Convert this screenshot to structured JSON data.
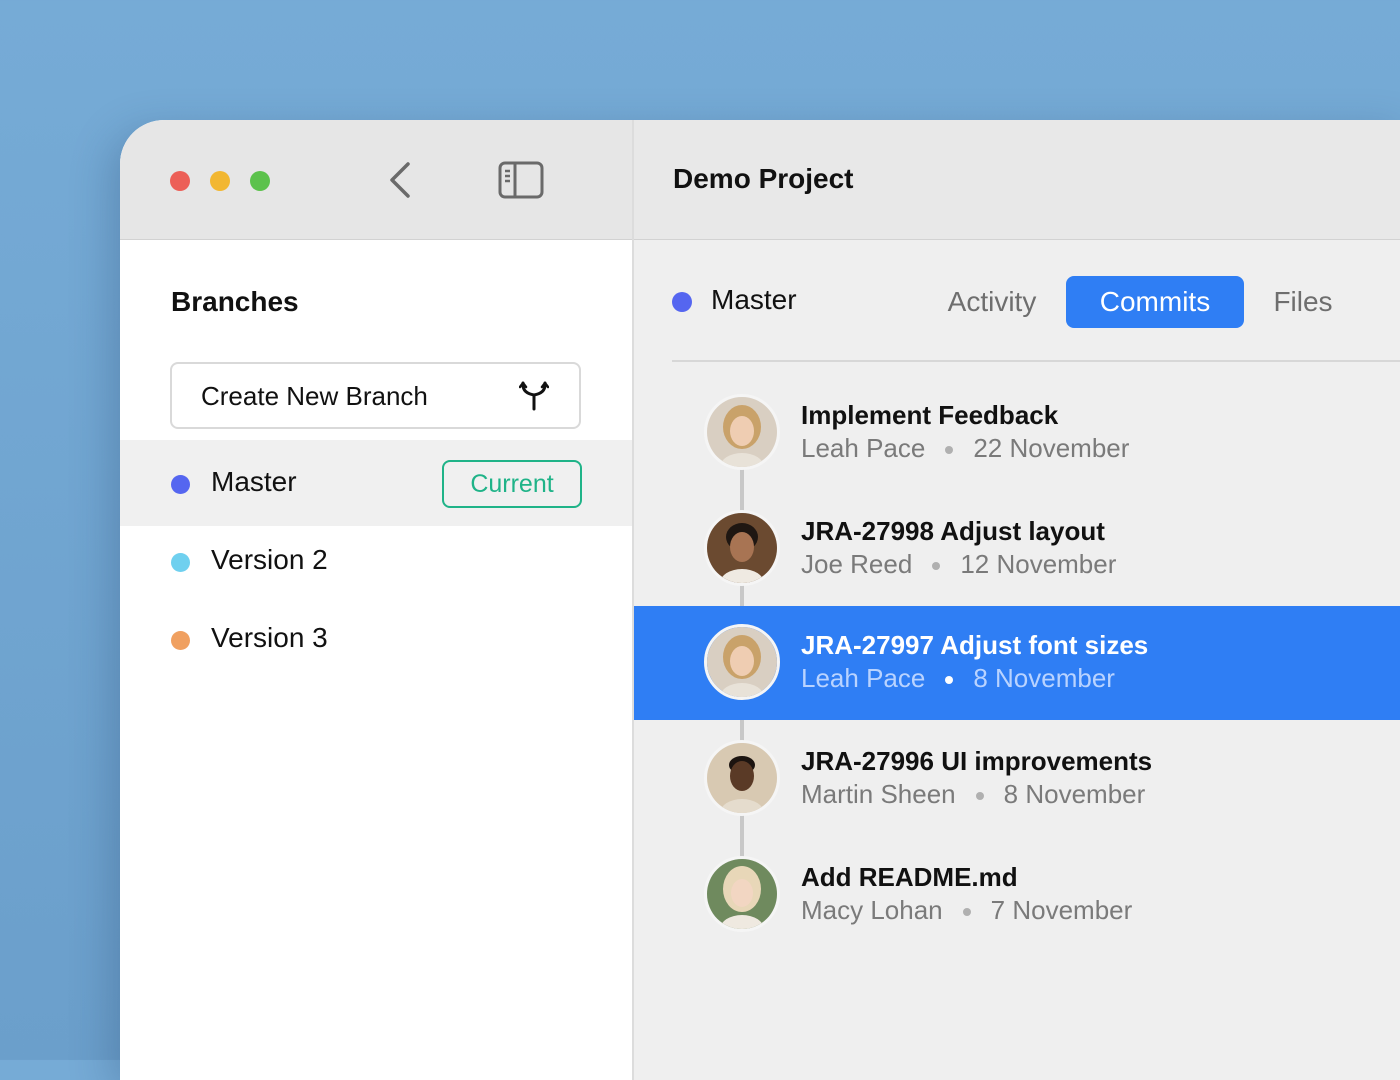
{
  "window": {
    "traffic_lights": [
      "close",
      "minimize",
      "zoom"
    ],
    "toolbar_icons": [
      "chevron-left-icon",
      "sidebar-icon"
    ]
  },
  "sidebar": {
    "title": "Branches",
    "create_branch_label": "Create New Branch",
    "create_branch_icon": "branch-icon",
    "branches": [
      {
        "label": "Master",
        "color": "#5566f0",
        "badge": "Current",
        "active": true
      },
      {
        "label": "Version 2",
        "color": "#6fd0ef",
        "badge": "",
        "active": false
      },
      {
        "label": "Version 3",
        "color": "#f0a060",
        "badge": "",
        "active": false
      }
    ]
  },
  "main": {
    "title": "Demo Project",
    "branch_label": "Master",
    "branch_color": "#5566f0",
    "tabs": [
      {
        "label": "Activity",
        "active": false
      },
      {
        "label": "Commits",
        "active": true
      },
      {
        "label": "Files",
        "active": false
      }
    ],
    "commits": [
      {
        "title": "Implement Feedback",
        "author": "Leah Pace",
        "date": "22 November",
        "selected": false
      },
      {
        "title": "JRA-27998 Adjust layout",
        "author": "Joe Reed",
        "date": "12 November",
        "selected": false
      },
      {
        "title": "JRA-27997 Adjust font sizes",
        "author": "Leah Pace",
        "date": "8 November",
        "selected": true
      },
      {
        "title": "JRA-27996 UI improvements",
        "author": "Martin Sheen",
        "date": "8 November",
        "selected": false
      },
      {
        "title": "Add README.md",
        "author": "Macy Lohan",
        "date": "7 November",
        "selected": false
      }
    ]
  },
  "colors": {
    "accent": "#2f7ef4",
    "current_badge": "#1fb388",
    "background": "#76abd6"
  }
}
